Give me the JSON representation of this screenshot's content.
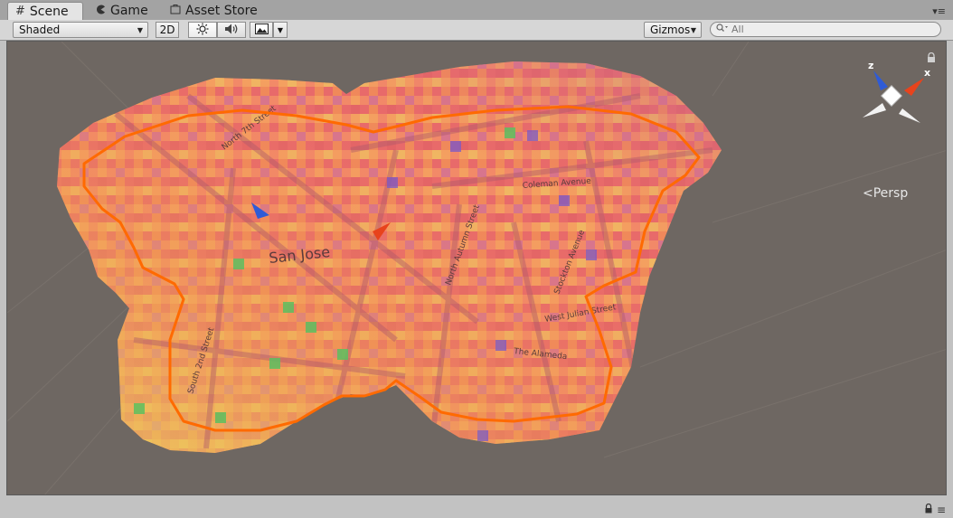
{
  "tabs": [
    {
      "label": "Scene",
      "icon": "grid-icon"
    },
    {
      "label": "Game",
      "icon": "pacman-icon"
    },
    {
      "label": "Asset Store",
      "icon": "store-icon"
    }
  ],
  "toolbar": {
    "shading_mode": "Shaded",
    "mode_2d": "2D",
    "gizmos_label": "Gizmos",
    "search_placeholder": "All"
  },
  "scene": {
    "map_labels": [
      "San Jose",
      "North 7th Street",
      "Coleman Avenue",
      "The Alameda",
      "Stockton Avenue",
      "North Autumn Street",
      "South 2nd Street",
      "West Julian Street"
    ],
    "outline_color": "#ff6a00",
    "background_color": "#6e6762"
  },
  "view_gizmo": {
    "axis_x": "x",
    "axis_z": "z",
    "projection_label": "Persp"
  }
}
